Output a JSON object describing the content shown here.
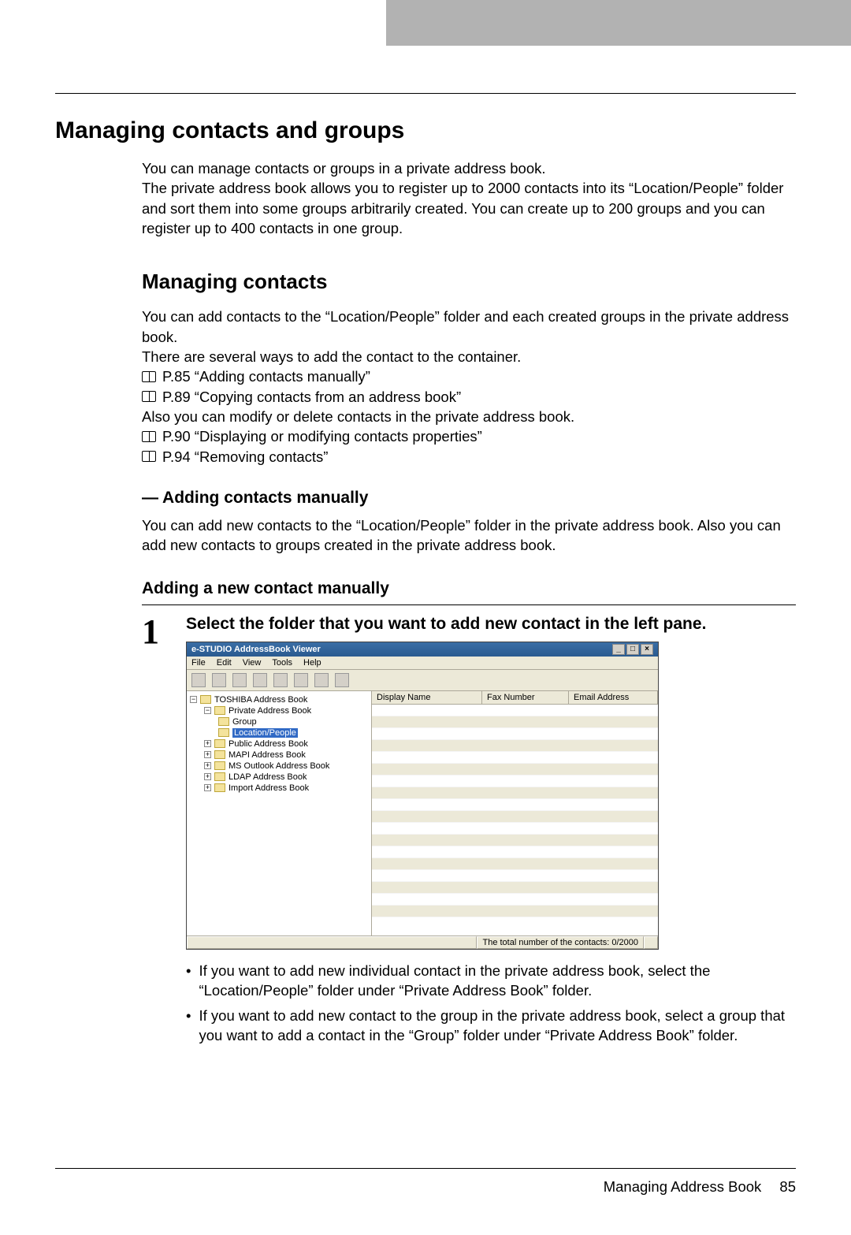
{
  "h1": "Managing contacts and groups",
  "intro": "You can manage contacts or groups in a private address book.\nThe private address book allows you to register up to 2000 contacts into its “Location/People” folder and sort them into some groups arbitrarily created. You can create up to 200 groups and you can register up to 400 contacts in one group.",
  "h2": "Managing contacts",
  "p2a": "You can add contacts to the “Location/People” folder and each created groups in the private address book.",
  "p2b": "There are several ways to add the contact to the container.",
  "ref1": "P.85 “Adding contacts manually”",
  "ref2": "P.89 “Copying contacts from an address book”",
  "p2c": "Also you can modify or delete contacts in the private address book.",
  "ref3": "P.90 “Displaying or modifying contacts properties”",
  "ref4": "P.94 “Removing contacts”",
  "h3": "— Adding contacts manually",
  "p3": "You can add new contacts to the “Location/People” folder in the private address book. Also you can add new contacts to groups created in the private address book.",
  "h4": "Adding a new contact manually",
  "step_num": "1",
  "step_title": "Select the folder that you want to add new contact in the left pane.",
  "screenshot": {
    "title": "e-STUDIO AddressBook Viewer",
    "menus": [
      "File",
      "Edit",
      "View",
      "Tools",
      "Help"
    ],
    "tree": [
      {
        "level": 0,
        "exp": "-",
        "label": "TOSHIBA Address Book"
      },
      {
        "level": 1,
        "exp": "-",
        "label": "Private Address Book"
      },
      {
        "level": 2,
        "exp": "",
        "label": "Group"
      },
      {
        "level": 2,
        "exp": "",
        "label": "Location/People",
        "selected": true
      },
      {
        "level": 1,
        "exp": "+",
        "label": "Public Address Book"
      },
      {
        "level": 1,
        "exp": "+",
        "label": "MAPI Address Book"
      },
      {
        "level": 1,
        "exp": "+",
        "label": "MS Outlook Address Book"
      },
      {
        "level": 1,
        "exp": "+",
        "label": "LDAP Address Book"
      },
      {
        "level": 1,
        "exp": "+",
        "label": "Import Address Book"
      }
    ],
    "columns": [
      "Display Name",
      "Fax Number",
      "Email Address"
    ],
    "status": "The total number of the contacts: 0/2000"
  },
  "bullet1": "If you want to add new individual contact in the private address book, select the “Location/People” folder under “Private Address Book” folder.",
  "bullet2": "If you want to add new contact to the group in the private address book, select a group that you want to add a contact in the “Group” folder under “Private Address Book” folder.",
  "footer_label": "Managing Address Book",
  "footer_page": "85"
}
